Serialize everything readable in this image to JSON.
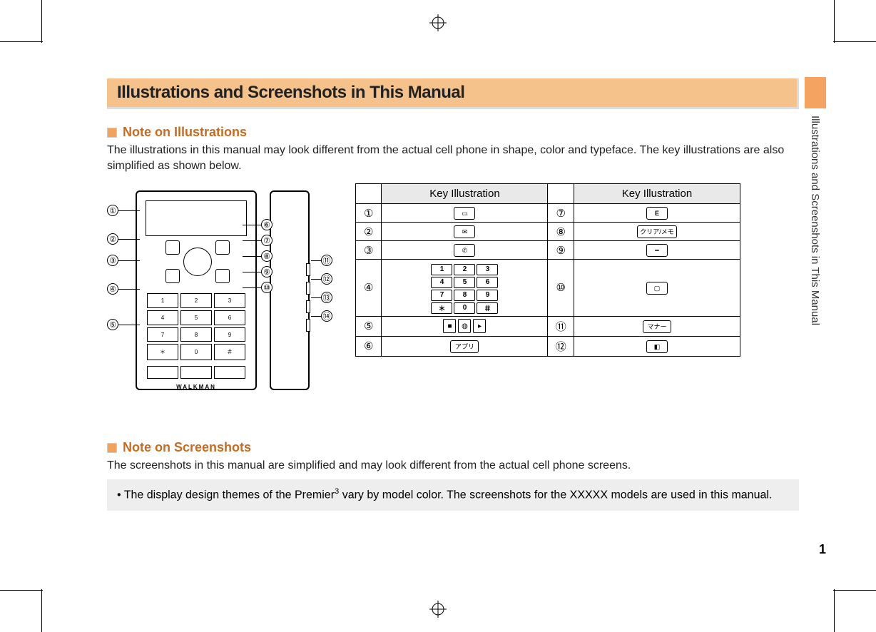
{
  "title": "Illustrations and Screenshots in This Manual",
  "side_tab": "Illustrations and Screenshots in This Manual",
  "page_number": "1",
  "sect1": {
    "heading": "Note on Illustrations",
    "body": "The illustrations in this manual may look different from the actual cell phone in shape, color and typeface. The key illustrations are also simplified as shown below."
  },
  "phone_logo": "WALKMAN",
  "callouts_front_left": [
    "①",
    "②",
    "③",
    "④",
    "⑤"
  ],
  "callouts_front_right": [
    "⑥",
    "⑦",
    "⑧",
    "⑨",
    "⑩"
  ],
  "callouts_side": [
    "⑪",
    "⑫",
    "⑬",
    "⑭"
  ],
  "table": {
    "header": "Key Illustration",
    "rows": [
      {
        "n1": "①",
        "i1": "book-icon",
        "n2": "⑦",
        "i2": "e-icon"
      },
      {
        "n1": "②",
        "i1": "mail-icon",
        "n2": "⑧",
        "i2": "clear-memo",
        "label2": "クリア/メモ"
      },
      {
        "n1": "③",
        "i1": "call-icon",
        "n2": "⑨",
        "i2": "end-icon"
      },
      {
        "n1": "④",
        "i1": "numpad",
        "n2": "⑩",
        "i2": "win-icon"
      },
      {
        "n1": "⑤",
        "i1": "center-trio",
        "n2": "⑪",
        "i2": "manner",
        "label2": "マナー"
      },
      {
        "n1": "⑥",
        "i1": "appli",
        "label1": "アプリ",
        "n2": "⑫",
        "i2": "camera-icon"
      }
    ],
    "numpad": [
      "1",
      "2",
      "3",
      "4",
      "5",
      "6",
      "7",
      "8",
      "9",
      "＊",
      "0",
      "＃"
    ]
  },
  "sect2": {
    "heading": "Note on Screenshots",
    "body": "The screenshots in this manual are simplified and may look different from the actual cell phone screens.",
    "note_prefix": "• The display design themes of the Premier",
    "note_sup": "3",
    "note_suffix": " vary by model color. The screenshots for the XXXXX models are used in this manual."
  }
}
